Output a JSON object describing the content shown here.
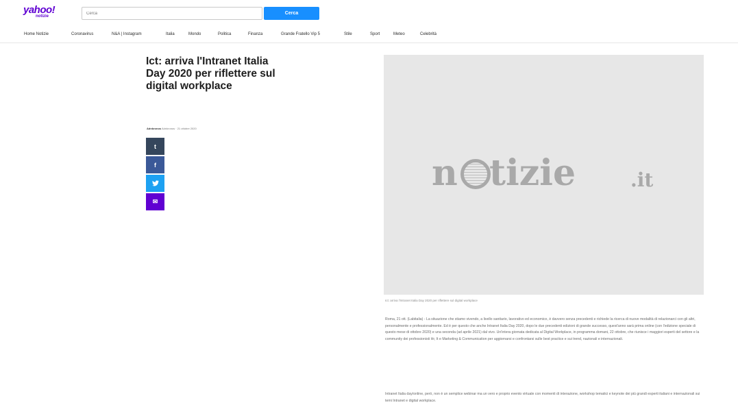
{
  "header": {
    "logo": {
      "main": "yahoo!",
      "sub": "notizie"
    },
    "search": {
      "placeholder": "Cerca",
      "button_label": "Cerca"
    }
  },
  "nav": {
    "items": [
      "Home Notizie",
      "Coronavirus",
      "N&A | Instagram",
      "Italia",
      "Mondo",
      "Politica",
      "Finanza",
      "Grande Fratello Vip 5",
      "Stile",
      "Sport",
      "Meteo",
      "Celebrità"
    ]
  },
  "article": {
    "headline": "Ict: arriva l'Intranet Italia Day 2020 per riflettere sul digital workplace",
    "byline": {
      "source": "Adnkronos",
      "sep": "·",
      "date": "Adnkronos · 21 ottobre 2020"
    },
    "share": {
      "tumblr": "t",
      "facebook": "f",
      "twitter": "t",
      "email": "✉"
    },
    "image": {
      "brand_left": "n",
      "brand_mid": "tizie",
      "brand_tld": ".it"
    },
    "caption": "Ict: arriva l'Intranet Italia Day 2020 per riflettere sul digital workplace",
    "paragraphs": [
      "Roma, 21 ott. (Labitalia) - La situazione che stiamo vivendo, a livello sanitario, lavorativo ed economico, è davvero senza precedenti e richiede la ricerca di nuove modalità di relazionarci con gli altri, personalmente e professionalmente. Ed è per questo che anche Intranet Italia Day 2020, dopo le due precedenti edizioni di grande successo, quest'anno sarà prima online (con l'edizione speciale di questo mese di ottobre 2020) e una seconda (ad aprile 2021) dal vivo. Un'intera giornata dedicata al Digital Workplace, in programma domani, 22 ottobre, che riunisce i maggiori esperti del settore e la community dei professionisti Hr, It e Marketing & Communication per aggiornarsi e confrontarsi sulle best practice e sui trend, nazionali e internazionali.",
      "Intranet Italia day/online, però, non è un semplice webinar ma un vero e proprio evento virtuale con momenti di interazione, workshop tematici e keynote dei più grandi esperti italiani e internazionali sui temi Intranet e digital workplace."
    ]
  },
  "colors": {
    "brand_purple": "#6001d2",
    "search_blue": "#188fff",
    "tumblr": "#35465c",
    "facebook": "#3b5998",
    "twitter": "#1da1f2",
    "email": "#6001d2"
  }
}
